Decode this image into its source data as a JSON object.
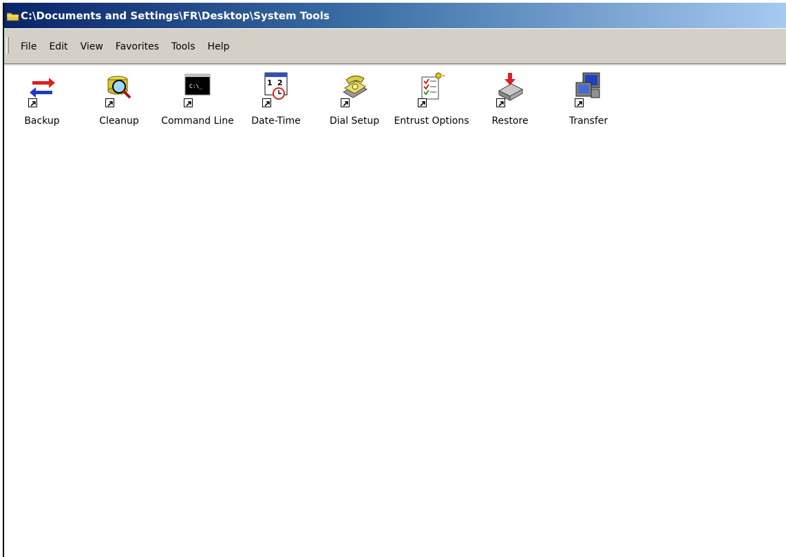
{
  "window": {
    "title": "C:\\Documents and Settings\\FR\\Desktop\\System Tools",
    "title_icon": "folder-icon"
  },
  "menu": {
    "items": [
      {
        "label": "File"
      },
      {
        "label": "Edit"
      },
      {
        "label": "View"
      },
      {
        "label": "Favorites"
      },
      {
        "label": "Tools"
      },
      {
        "label": "Help"
      }
    ]
  },
  "icons": [
    {
      "label": "Backup",
      "icon": "backup-arrows-icon"
    },
    {
      "label": "Cleanup",
      "icon": "cleanup-disk-icon"
    },
    {
      "label": "Command Line",
      "icon": "command-prompt-icon"
    },
    {
      "label": "Date-Time",
      "icon": "calendar-clock-icon"
    },
    {
      "label": "Dial Setup",
      "icon": "telephone-icon"
    },
    {
      "label": "Entrust Options",
      "icon": "checklist-key-icon"
    },
    {
      "label": "Restore",
      "icon": "restore-drive-icon"
    },
    {
      "label": "Transfer",
      "icon": "computer-transfer-icon"
    }
  ],
  "colors": {
    "titlebar_start": "#0a246a",
    "titlebar_end": "#a6caf0",
    "menubar": "#d4d0c8"
  }
}
